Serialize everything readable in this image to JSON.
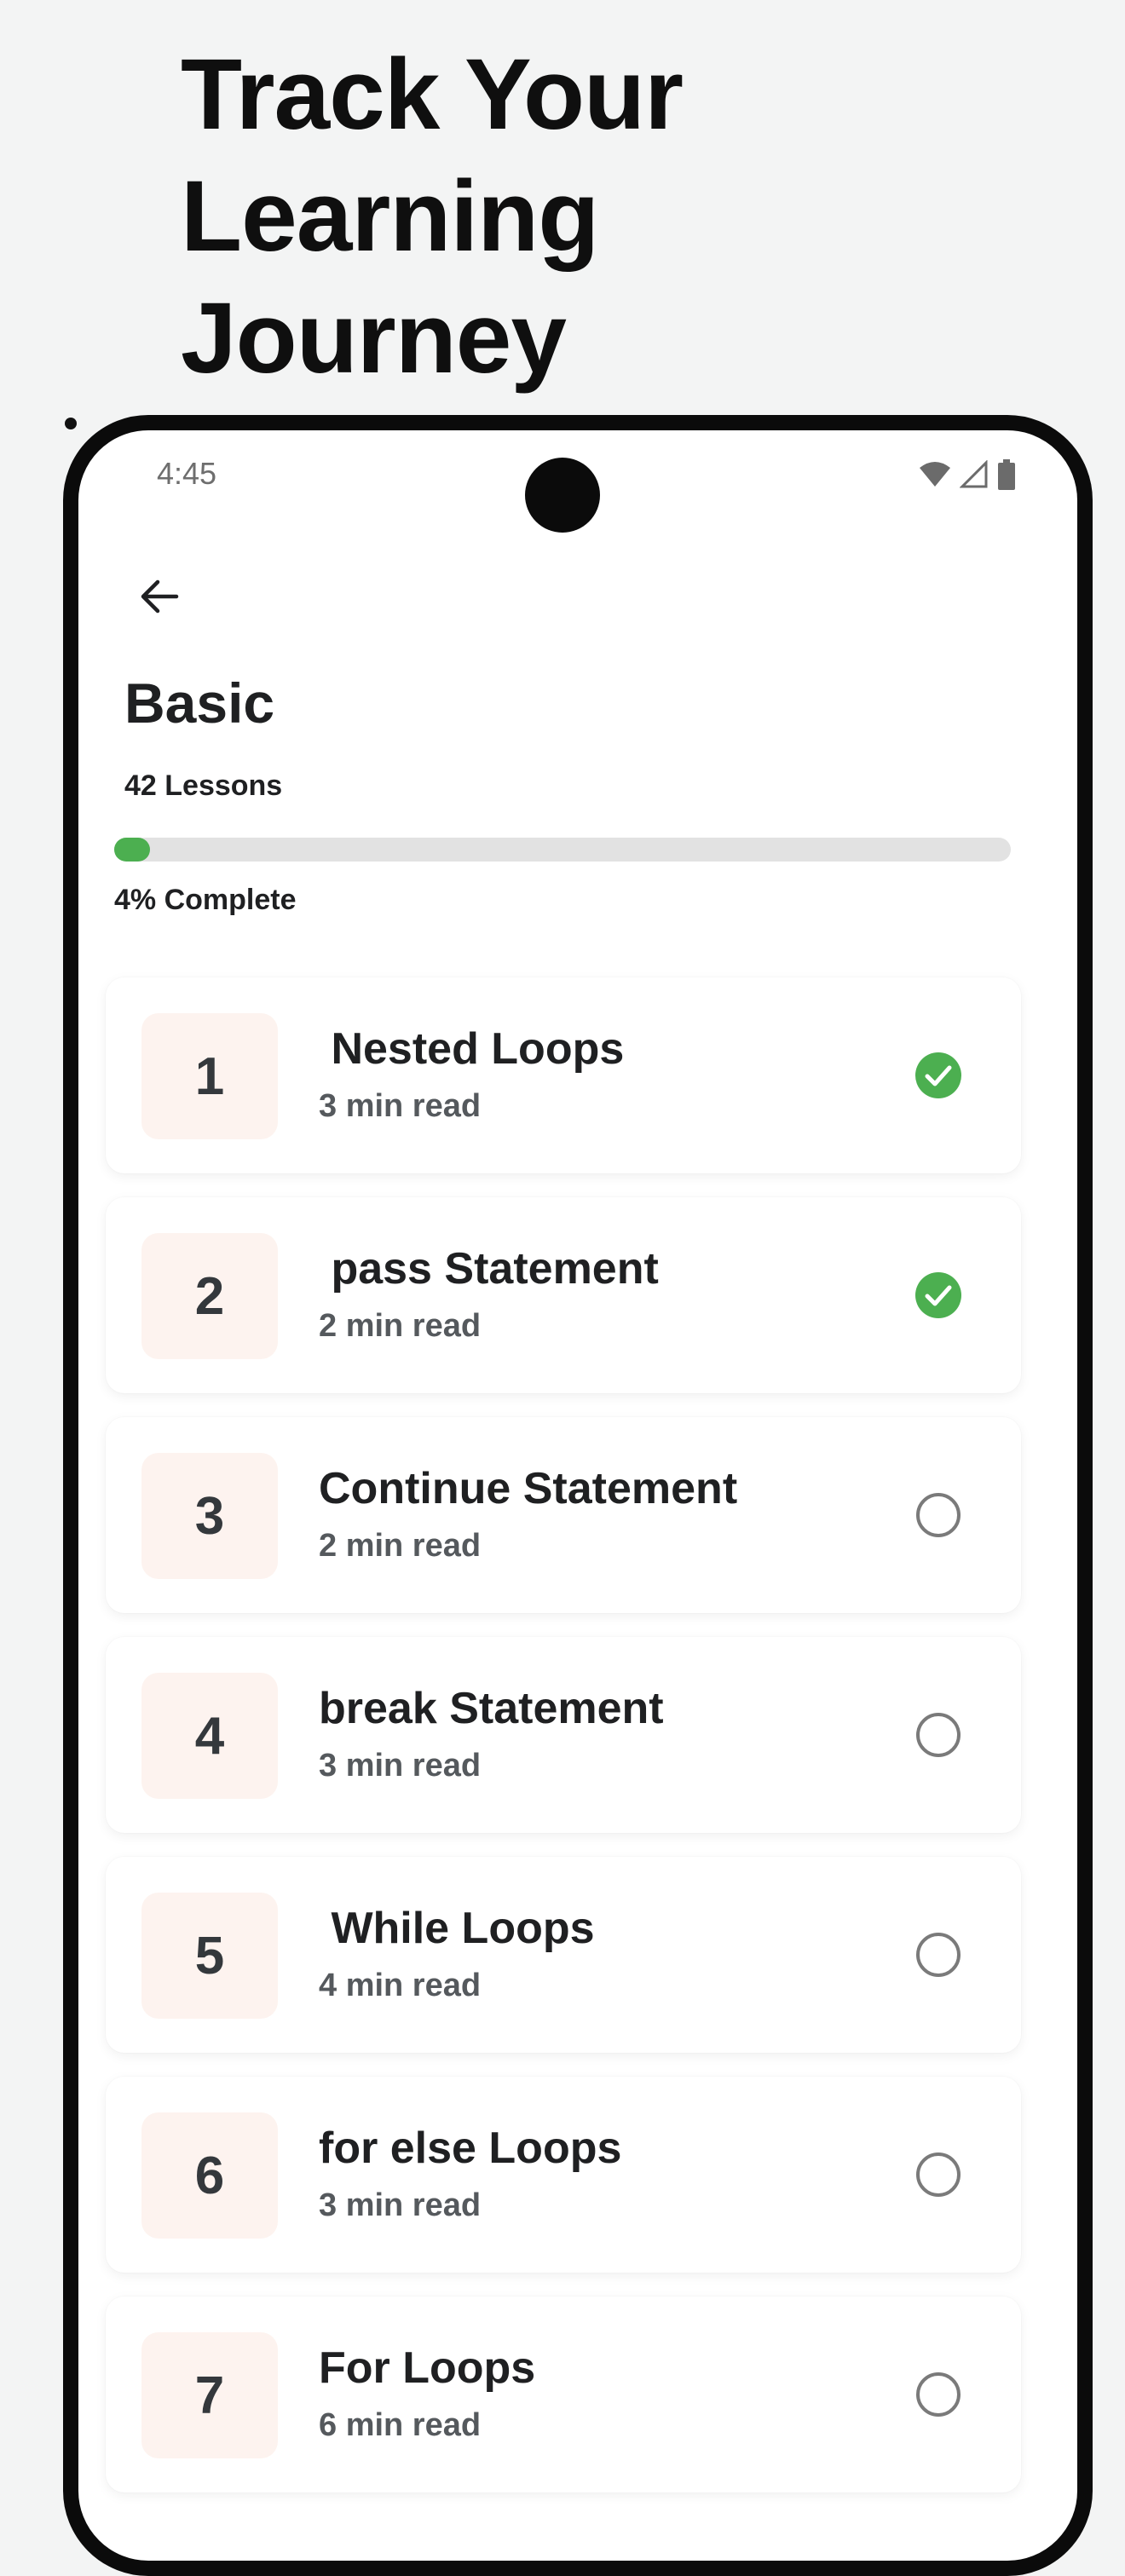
{
  "headline": {
    "lines": [
      "Track Your",
      "Learning",
      "Journey"
    ]
  },
  "status_bar": {
    "time": "4:45"
  },
  "course": {
    "title": "Basic",
    "lessons_count": "42 Lessons",
    "progress_percent": 4,
    "progress_label": "4% Complete"
  },
  "lessons": [
    {
      "number": "1",
      "title": " Nested Loops",
      "duration": "3 min read",
      "completed": true
    },
    {
      "number": "2",
      "title": " pass Statement",
      "duration": "2 min read",
      "completed": true
    },
    {
      "number": "3",
      "title": "Continue Statement",
      "duration": "2 min read",
      "completed": false
    },
    {
      "number": "4",
      "title": "break Statement",
      "duration": "3 min read",
      "completed": false
    },
    {
      "number": "5",
      "title": " While Loops",
      "duration": "4 min read",
      "completed": false
    },
    {
      "number": "6",
      "title": "for else Loops",
      "duration": "3 min read",
      "completed": false
    },
    {
      "number": "7",
      "title": "For Loops",
      "duration": "6 min read",
      "completed": false
    }
  ],
  "colors": {
    "accent": "#4caf50",
    "number_box": "#fdf3ef",
    "text": "#1f2022"
  },
  "icons": {
    "back": "arrow-left-icon",
    "done": "check-circle-icon",
    "pending": "empty-circle-icon"
  }
}
